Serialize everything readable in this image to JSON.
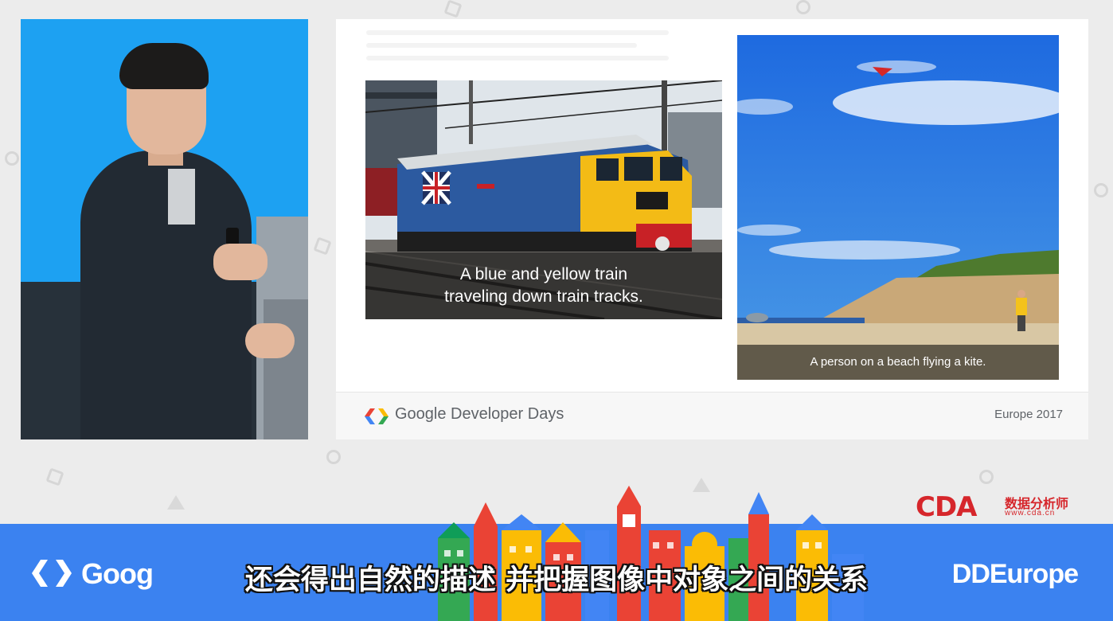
{
  "slide": {
    "train_caption_line1": "A blue and yellow train",
    "train_caption_line2": "traveling down train tracks.",
    "beach_caption": "A person on a beach flying a kite.",
    "footer_brand": "Google Developer Days",
    "footer_edition": "Europe 2017"
  },
  "watermark": {
    "mark": "CDA",
    "name_cn": "数据分析师",
    "url": "www.cda.cn",
    "color": "#d6262b"
  },
  "banner": {
    "left_brand": "Goog",
    "right_brand": "DDEurope",
    "color": "#3b82f0"
  },
  "subtitle": {
    "text": "还会得出自然的描述 并把握图像中对象之间的关系"
  },
  "icons": [
    "gdd-logo-icon",
    "kite-icon",
    "union-flag-icon"
  ]
}
